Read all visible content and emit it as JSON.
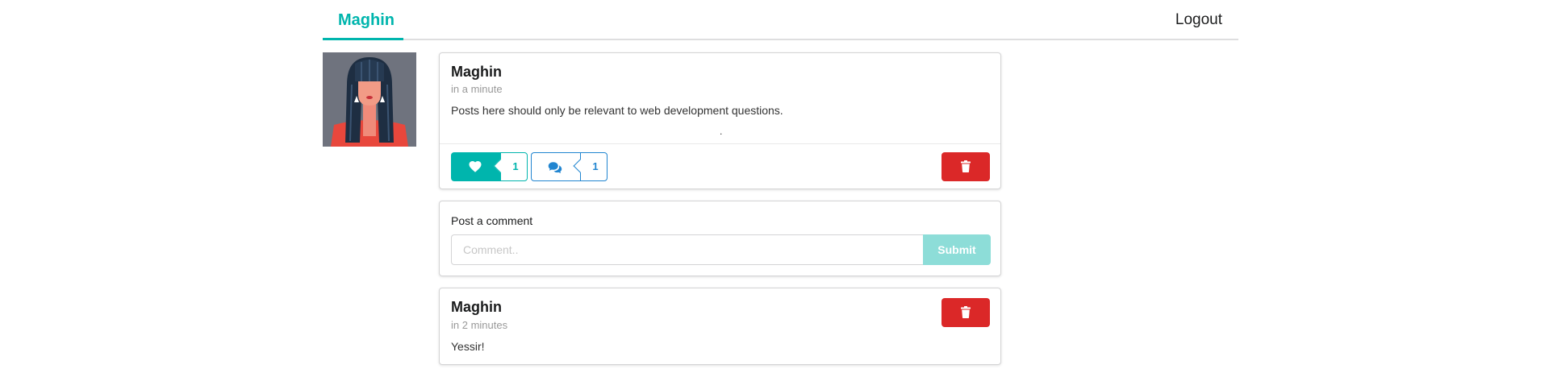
{
  "menu": {
    "active_item": "Maghin",
    "logout_label": "Logout"
  },
  "post": {
    "author": "Maghin",
    "time": "in a minute",
    "body": "Posts here should only be relevant to web development questions.",
    "dot": ".",
    "like_count": "1",
    "comment_count": "1"
  },
  "comment_form": {
    "label": "Post a comment",
    "placeholder": "Comment..",
    "submit_label": "Submit"
  },
  "comments": [
    {
      "author": "Maghin",
      "time": "in 2 minutes",
      "body": "Yessir!"
    }
  ],
  "colors": {
    "teal": "#00b5ad",
    "blue": "#2185d0",
    "red": "#db2828",
    "submit_disabled": "#8dddd8"
  },
  "icons": {
    "like": "heart-icon",
    "comment": "comments-icon",
    "delete": "trash-icon"
  }
}
